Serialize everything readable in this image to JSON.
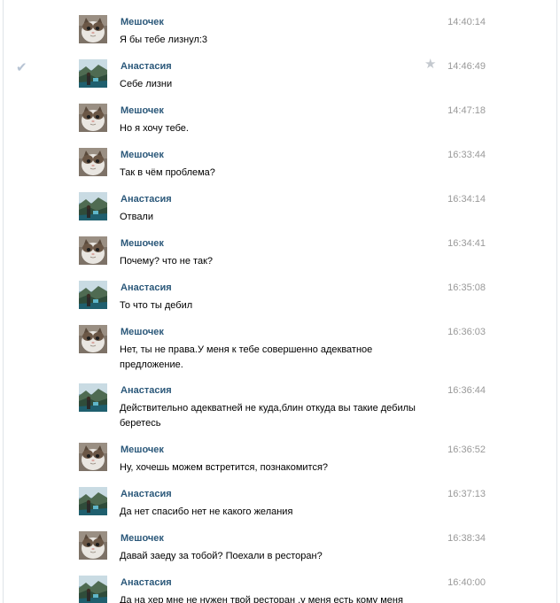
{
  "messages": [
    {
      "author": "Мешочек",
      "avatar": "cat-avatar",
      "time": "14:40:14",
      "text": "Я бы тебе лизнул:3"
    },
    {
      "author": "Анастасия",
      "avatar": "landscape-avatar",
      "time": "14:46:49",
      "text": "Себе лизни",
      "checkmark": true,
      "star": true
    },
    {
      "author": "Мешочек",
      "avatar": "cat-avatar",
      "time": "14:47:18",
      "text": "Но я хочу тебе."
    },
    {
      "author": "Мешочек",
      "avatar": "cat-avatar",
      "time": "16:33:44",
      "text": "Так в чём проблема?"
    },
    {
      "author": "Анастасия",
      "avatar": "landscape-avatar",
      "time": "16:34:14",
      "text": "Отвали"
    },
    {
      "author": "Мешочек",
      "avatar": "cat-avatar",
      "time": "16:34:41",
      "text": "Почему? что не так?"
    },
    {
      "author": "Анастасия",
      "avatar": "landscape-avatar",
      "time": "16:35:08",
      "text": "То что ты дебил"
    },
    {
      "author": "Мешочек",
      "avatar": "cat-avatar",
      "time": "16:36:03",
      "text": "Нет, ты не права.У меня к тебе совершенно адекватное предложение."
    },
    {
      "author": "Анастасия",
      "avatar": "landscape-avatar",
      "time": "16:36:44",
      "text": "Действительно адекватней не куда,блин откуда вы такие дебилы беретесь"
    },
    {
      "author": "Мешочек",
      "avatar": "cat-avatar",
      "time": "16:36:52",
      "text": "Ну, хочешь можем встретится, познакомится?"
    },
    {
      "author": "Анастасия",
      "avatar": "landscape-avatar",
      "time": "16:37:13",
      "text": "Да нет спасибо нет не какого желания"
    },
    {
      "author": "Мешочек",
      "avatar": "cat-avatar",
      "time": "16:38:34",
      "text": "Давай заеду за тобой? Поехали в ресторан?"
    },
    {
      "author": "Анастасия",
      "avatar": "landscape-avatar",
      "time": "16:40:00",
      "text": "Да на хер мне не нужен твой ресторан ,у меня есть кому меня"
    }
  ],
  "icons": {
    "checkmark": "✔",
    "star": "★"
  },
  "colors": {
    "author_name": "#2b587a",
    "timestamp": "#999999",
    "checkmark": "#b7c4d4",
    "star": "#c4c9cf",
    "border": "#dfe3e8"
  }
}
